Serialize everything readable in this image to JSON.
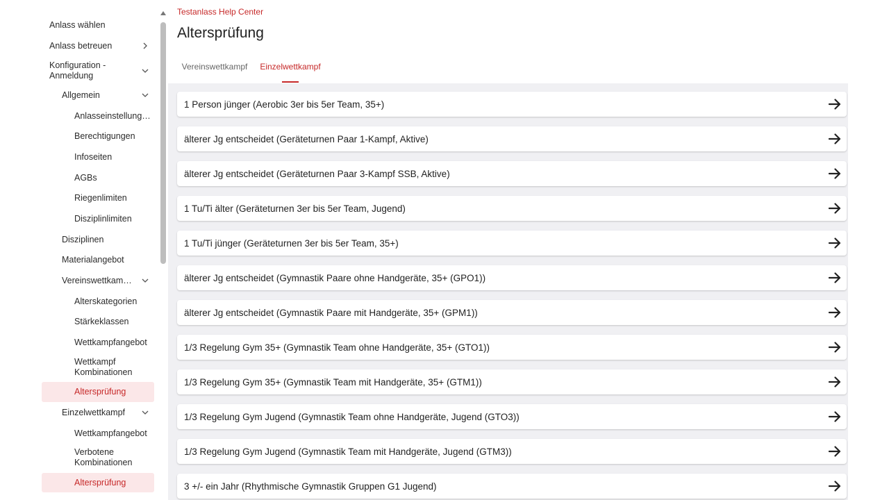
{
  "sidebar": {
    "items": [
      {
        "label": "Anlass wählen"
      },
      {
        "label": "Anlass betreuen"
      },
      {
        "label": "Konfiguration - Anmeldung"
      },
      {
        "label": "Allgemein"
      },
      {
        "label": "Anlasseinstellung…"
      },
      {
        "label": "Berechtigungen"
      },
      {
        "label": "Infoseiten"
      },
      {
        "label": "AGBs"
      },
      {
        "label": "Riegenlimiten"
      },
      {
        "label": "Disziplinlimiten"
      },
      {
        "label": "Disziplinen"
      },
      {
        "label": "Materialangebot"
      },
      {
        "label": "Vereinswettkam…"
      },
      {
        "label": "Alterskategorien"
      },
      {
        "label": "Stärkeklassen"
      },
      {
        "label": "Wettkampfangebot"
      },
      {
        "label": "Wettkampf Kombinationen"
      },
      {
        "label": "Altersprüfung"
      },
      {
        "label": "Einzelwettkampf"
      },
      {
        "label": "Wettkampfangebot"
      },
      {
        "label": "Verbotene Kombinationen"
      },
      {
        "label": "Altersprüfung"
      }
    ]
  },
  "header": {
    "breadcrumb": "Testanlass Help Center",
    "title": "Altersprüfung"
  },
  "tabs": [
    {
      "label": "Vereinswettkampf"
    },
    {
      "label": "Einzelwettkampf"
    }
  ],
  "rules": [
    {
      "label": "1 Person jünger (Aerobic 3er bis 5er Team, 35+)"
    },
    {
      "label": "älterer Jg entscheidet (Geräteturnen Paar 1-Kampf, Aktive)"
    },
    {
      "label": "älterer Jg entscheidet (Geräteturnen Paar 3-Kampf SSB, Aktive)"
    },
    {
      "label": "1 Tu/Ti älter (Geräteturnen 3er bis 5er Team, Jugend)"
    },
    {
      "label": "1 Tu/Ti jünger (Geräteturnen 3er bis 5er Team, 35+)"
    },
    {
      "label": "älterer Jg entscheidet (Gymnastik Paare ohne Handgeräte, 35+ (GPO1))"
    },
    {
      "label": "älterer Jg entscheidet (Gymnastik Paare mit Handgeräte, 35+ (GPM1))"
    },
    {
      "label": "1/3 Regelung Gym 35+ (Gymnastik Team ohne Handgeräte, 35+ (GTO1))"
    },
    {
      "label": "1/3 Regelung Gym 35+ (Gymnastik Team mit Handgeräte, 35+ (GTM1))"
    },
    {
      "label": "1/3 Regelung Gym Jugend (Gymnastik Team ohne Handgeräte, Jugend (GTO3))"
    },
    {
      "label": "1/3 Regelung Gym Jugend (Gymnastik Team mit Handgeräte, Jugend (GTM3))"
    },
    {
      "label": "3 +/- ein Jahr (Rhythmische Gymnastik Gruppen G1 Jugend)"
    }
  ],
  "colors": {
    "accent": "#c62828",
    "active_bg": "#fbe7e8",
    "list_bg": "#f0f0f3"
  }
}
